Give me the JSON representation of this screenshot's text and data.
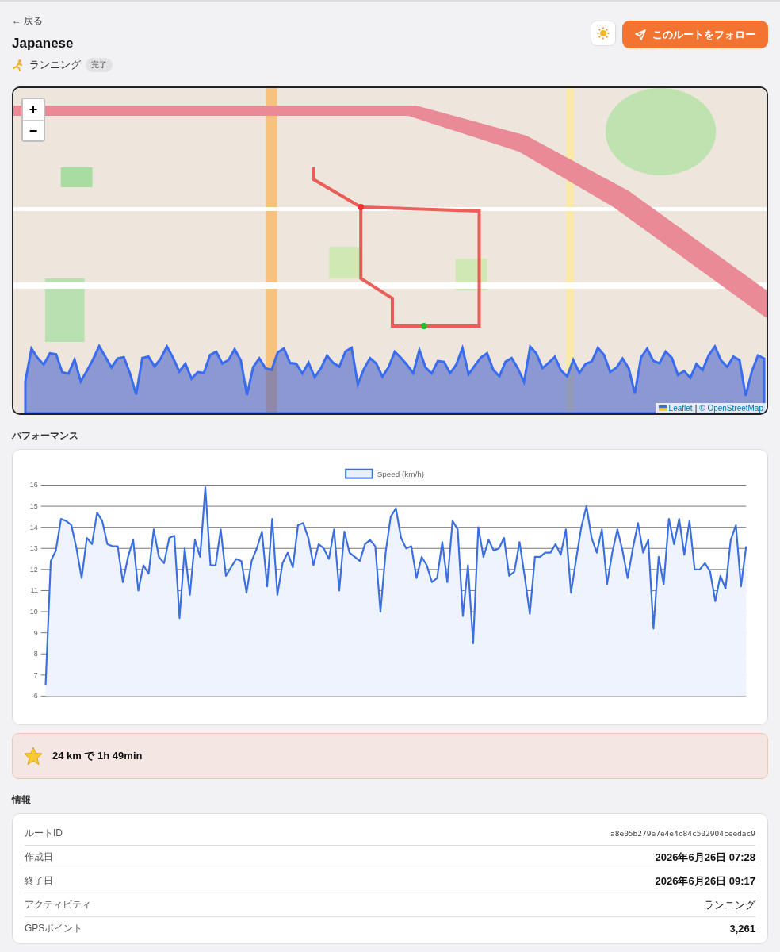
{
  "back_link": "← 戻る",
  "title": "Japanese",
  "activity": {
    "label": "ランニング",
    "status": "完了"
  },
  "follow_button": "このルートをフォロー",
  "map": {
    "kind": "picture",
    "zoom_in": "+",
    "zoom_out": "−",
    "attribution": {
      "leaflet": "Leaflet",
      "separator": "|",
      "osm": "© OpenStreetMap"
    }
  },
  "performance": {
    "heading": "パフォーマンス",
    "chart_data": {
      "type": "area",
      "grid": true,
      "yticks": [
        6,
        7,
        8,
        9,
        10,
        11,
        12,
        13,
        14,
        15,
        16
      ],
      "ylim": [
        6,
        16
      ],
      "series": [
        {
          "name": "Speed (km/h)",
          "color": "#3b6fe0",
          "values": [
            6.5,
            12.4,
            12.9,
            14.4,
            14.3,
            14.1,
            13.0,
            11.6,
            13.5,
            13.2,
            14.7,
            14.3,
            13.2,
            13.1,
            13.1,
            11.4,
            12.6,
            13.4,
            11.0,
            12.2,
            11.8,
            13.9,
            12.6,
            12.3,
            13.5,
            13.6,
            9.7,
            13.0,
            10.8,
            13.4,
            12.6,
            15.9,
            12.2,
            12.2,
            13.9,
            11.7,
            12.1,
            12.5,
            12.4,
            10.9,
            12.4,
            13.0,
            13.8,
            11.2,
            14.4,
            10.8,
            12.3,
            12.8,
            12.1,
            14.1,
            14.2,
            13.5,
            12.2,
            13.2,
            13.0,
            12.5,
            13.9,
            11.0,
            13.8,
            12.8,
            12.6,
            12.4,
            13.2,
            13.4,
            13.1,
            10.0,
            12.8,
            14.5,
            14.9,
            13.5,
            13.0,
            13.1,
            11.6,
            12.6,
            12.2,
            11.4,
            11.6,
            13.3,
            11.4,
            14.3,
            13.9,
            9.8,
            12.2,
            8.5,
            14.0,
            12.6,
            13.4,
            12.9,
            13.0,
            13.5,
            11.7,
            11.9,
            13.3,
            11.7,
            9.9,
            12.6,
            12.6,
            12.8,
            12.8,
            13.2,
            12.7,
            13.9,
            10.9,
            12.5,
            14.0,
            15.0,
            13.5,
            12.8,
            13.9,
            11.3,
            12.8,
            13.9,
            12.9,
            11.6,
            13.0,
            14.2,
            12.8,
            13.4,
            9.2,
            12.6,
            11.3,
            14.4,
            13.2,
            14.4,
            12.7,
            14.3,
            12.0,
            12.0,
            12.3,
            11.9,
            10.5,
            11.7,
            11.1,
            13.4,
            14.1,
            11.2,
            13.1
          ]
        }
      ]
    }
  },
  "achievement": {
    "text": "24 km で 1h 49min"
  },
  "info": {
    "heading": "情報",
    "rows": [
      {
        "label": "ルートID",
        "value": "a8e05b279e7e4e4c84c502904ceedac9",
        "kind": "mono"
      },
      {
        "label": "作成日",
        "value": "2026年6月26日 07:28",
        "kind": "bold"
      },
      {
        "label": "終了日",
        "value": "2026年6月26日 09:17",
        "kind": "bold"
      },
      {
        "label": "アクティビティ",
        "value": "ランニング",
        "kind": "plain"
      },
      {
        "label": "GPSポイント",
        "value": "3,261",
        "kind": "bold"
      }
    ]
  }
}
